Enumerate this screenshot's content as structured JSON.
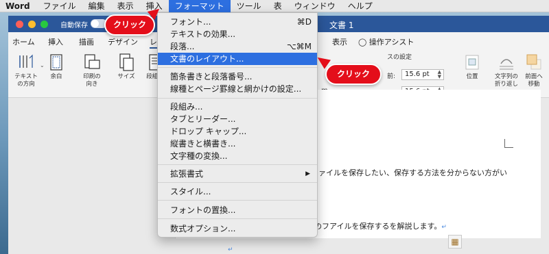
{
  "menubar": {
    "app_name": "Word",
    "items": [
      "ファイル",
      "編集",
      "表示",
      "挿入",
      "フォーマット",
      "ツール",
      "表",
      "ウィンドウ",
      "ヘルプ"
    ]
  },
  "window": {
    "autosave_label": "自動保存",
    "title": "文書 1"
  },
  "ribbon_tabs": [
    "ホーム",
    "挿入",
    "描画",
    "デザイン",
    "レ",
    "表示",
    "操作アシスト"
  ],
  "ribbon": {
    "text_direction": [
      "テキスト",
      "の方向"
    ],
    "margins": "余白",
    "orientation": [
      "印刷の",
      "向き"
    ],
    "size": "サイズ",
    "columns": "段組み",
    "spacing_group": "スの設定",
    "before_label": "前:",
    "after_label": "後:",
    "before_value": "15.6 pt",
    "after_value": "15.6 pt",
    "position": "位置",
    "wrap_text": [
      "文字列の",
      "折り返し"
    ],
    "bring_forward": [
      "前面へ",
      "移動"
    ],
    "fragment_m1": "m",
    "fragment_m2": "m"
  },
  "format_menu": {
    "items": [
      {
        "label": "フォント...",
        "shortcut": "⌘D"
      },
      {
        "label": "テキストの効果..."
      },
      {
        "label": "段落...",
        "shortcut": "⌥⌘M"
      },
      {
        "label": "文書のレイアウト...",
        "selected": true
      },
      {
        "label": "箇条書きと段落番号..."
      },
      {
        "label": "線種とページ罫線と網かけの設定..."
      },
      {
        "label": "段組み..."
      },
      {
        "label": "タブとリーダー..."
      },
      {
        "label": "ドロップ キャップ..."
      },
      {
        "label": "縦書きと横書き..."
      },
      {
        "label": "文字種の変換..."
      },
      {
        "label": "拡張書式",
        "submenu": true
      },
      {
        "label": "スタイル..."
      },
      {
        "label": "フォントの置換..."
      },
      {
        "label": "数式オプション..."
      }
    ]
  },
  "callouts": {
    "click1": "クリック",
    "click2": "クリック"
  },
  "document": {
    "line1": "ァイルを保存したい、保存する方法を分からない方がい",
    "line2": "のフアイルを保存するを解説します。"
  },
  "colors": {
    "accent": "#2d6fe0",
    "titlebar": "#2b579a",
    "callout": "#e40e1a"
  }
}
